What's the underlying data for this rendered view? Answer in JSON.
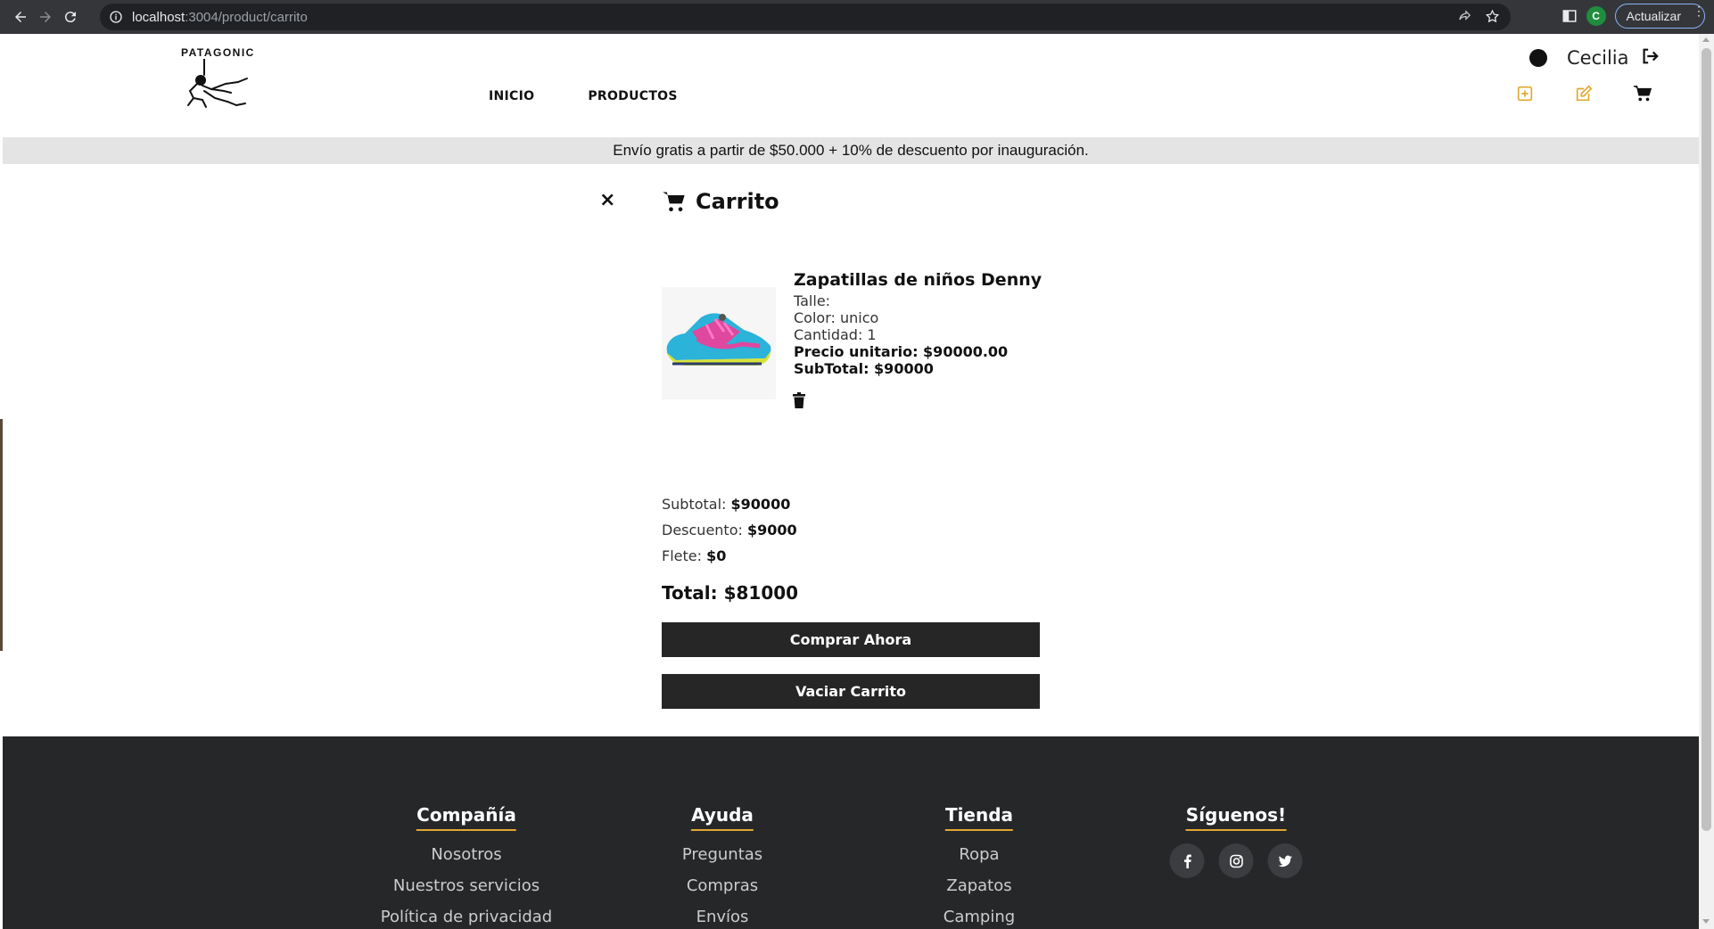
{
  "browser": {
    "url_host": "localhost",
    "url_path": ":3004/product/carrito",
    "profile_initial": "C",
    "update_label": "Actualizar"
  },
  "header": {
    "logo_text": "PATAGONIC",
    "nav": [
      "INICIO",
      "PRODUCTOS"
    ],
    "user_name": "Cecilia",
    "colors": {
      "tool_add": "#e0a82e",
      "tool_edit": "#e0a82e"
    }
  },
  "promo": {
    "text": "Envío gratis a partir de $50.000 + 10% de descuento por inauguración."
  },
  "cart": {
    "close_label": "×",
    "title": "Carrito",
    "item": {
      "name": "Zapatillas de niños Denny",
      "talle": "Talle:",
      "color": "Color: unico",
      "cantidad": "Cantidad: 1",
      "precio_unitario": "Precio unitario: $90000.00",
      "subtotal": "SubTotal: $90000"
    },
    "summary": {
      "subtotal_label": "Subtotal:",
      "subtotal_value": "$90000",
      "descuento_label": "Descuento:",
      "descuento_value": "$9000",
      "flete_label": "Flete:",
      "flete_value": "$0",
      "total": "Total: $81000"
    },
    "buy_label": "Comprar Ahora",
    "empty_label": "Vaciar Carrito"
  },
  "footer": {
    "compania": {
      "title": "Compañía",
      "links": [
        "Nosotros",
        "Nuestros servicios",
        "Política de privacidad"
      ]
    },
    "ayuda": {
      "title": "Ayuda",
      "links": [
        "Preguntas",
        "Compras",
        "Envíos"
      ]
    },
    "tienda": {
      "title": "Tienda",
      "links": [
        "Ropa",
        "Zapatos",
        "Camping"
      ]
    },
    "social": {
      "title": "Síguenos!",
      "icons": [
        "facebook-icon",
        "instagram-icon",
        "twitter-icon"
      ]
    },
    "accent_color": "#e0a82e"
  }
}
